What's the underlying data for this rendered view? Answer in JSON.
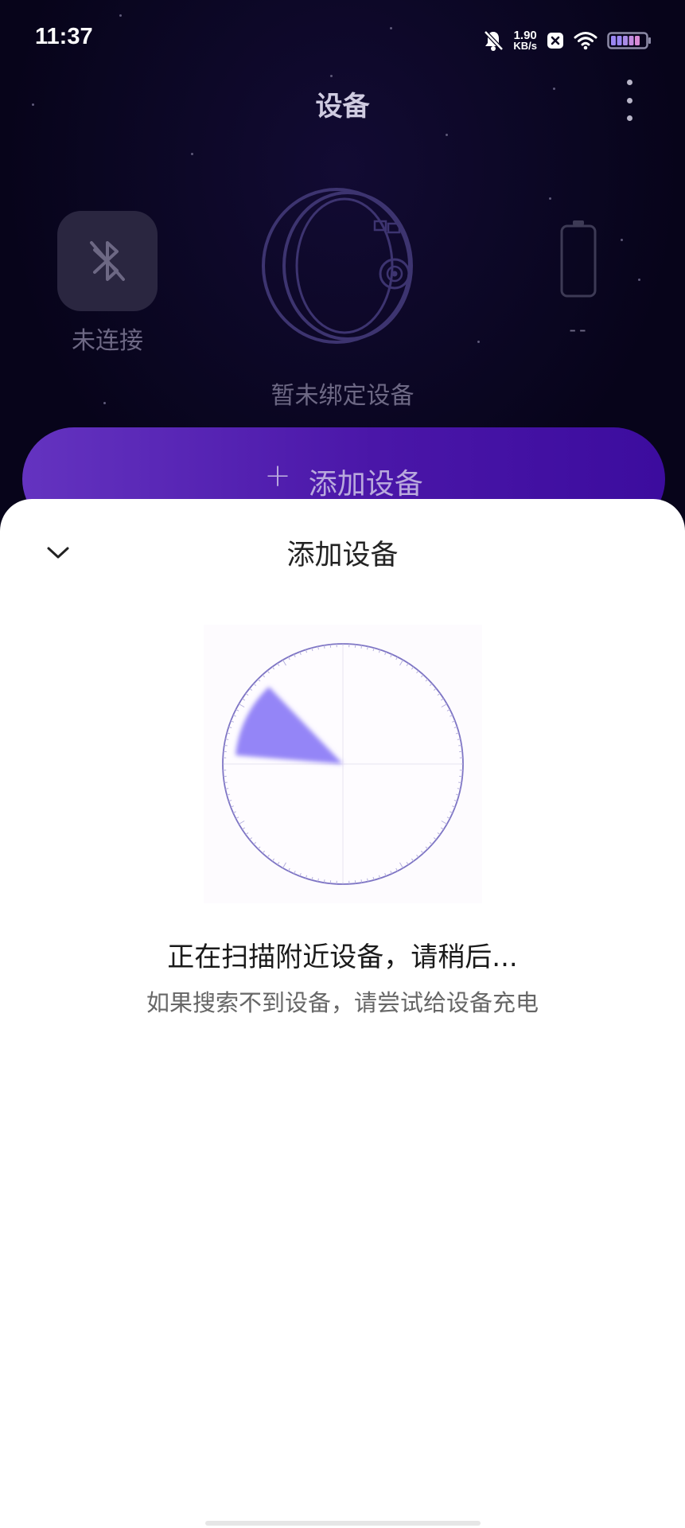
{
  "status_bar": {
    "time": "11:37",
    "net_speed_value": "1.90",
    "net_speed_unit": "KB/s",
    "icons": [
      "bell-muted-icon",
      "close-app-icon",
      "wifi-icon",
      "battery-icon"
    ]
  },
  "header": {
    "title": "设备",
    "more_icon": "more-vertical-icon"
  },
  "device_panel": {
    "bluetooth_status": "未连接",
    "device_status": "暂未绑定设备",
    "battery_level": "--"
  },
  "add_device_button": {
    "icon": "plus-icon",
    "label": "添加设备"
  },
  "sheet": {
    "title": "添加设备",
    "collapse_icon": "chevron-down-icon",
    "scan_message": "正在扫描附近设备，请稍后...",
    "hint": "如果搜索不到设备，请尝试给设备充电"
  },
  "colors": {
    "accent": "#5a1fb4",
    "radar_sweep": "#9485f7",
    "background_dark": "#08051c"
  }
}
